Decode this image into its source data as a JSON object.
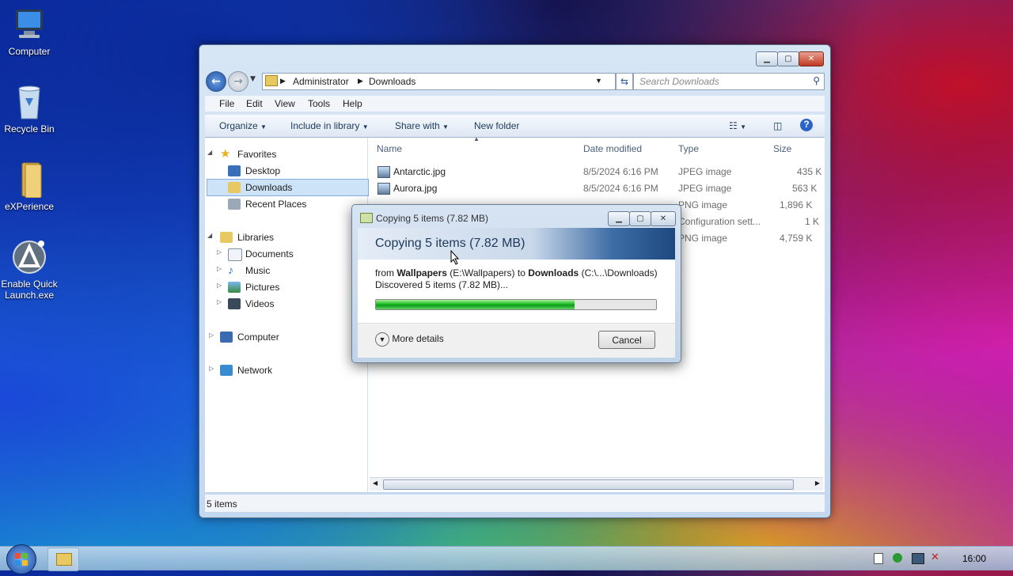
{
  "desktop": {
    "icons": [
      {
        "label": "Computer",
        "icon": "computer-icon"
      },
      {
        "label": "Recycle Bin",
        "icon": "recycle-bin-icon"
      },
      {
        "label": "eXPerience",
        "icon": "folder-icon"
      },
      {
        "label": "Enable Quick Launch.exe",
        "icon": "app-icon"
      }
    ]
  },
  "explorer": {
    "address": {
      "crumb1": "Administrator",
      "crumb2": "Downloads"
    },
    "search_placeholder": "Search Downloads",
    "menu": [
      "File",
      "Edit",
      "View",
      "Tools",
      "Help"
    ],
    "commands": {
      "organize": "Organize",
      "include": "Include in library",
      "share": "Share with",
      "new_folder": "New folder"
    },
    "nav": {
      "favorites": "Favorites",
      "desktop": "Desktop",
      "downloads": "Downloads",
      "recent": "Recent Places",
      "libraries": "Libraries",
      "documents": "Documents",
      "music": "Music",
      "pictures": "Pictures",
      "videos": "Videos",
      "computer": "Computer",
      "network": "Network"
    },
    "columns": {
      "name": "Name",
      "date": "Date modified",
      "type": "Type",
      "size": "Size"
    },
    "files": [
      {
        "name": "Antarctic.jpg",
        "date": "8/5/2024 6:16 PM",
        "type": "JPEG image",
        "size": "435 K"
      },
      {
        "name": "Aurora.jpg",
        "date": "8/5/2024 6:16 PM",
        "type": "JPEG image",
        "size": "563 K"
      },
      {
        "name": "",
        "date": "",
        "type": "PNG image",
        "size": "1,896 K"
      },
      {
        "name": "",
        "date": "",
        "type": "Configuration sett...",
        "size": "1 K"
      },
      {
        "name": "",
        "date": "",
        "type": "PNG image",
        "size": "4,759 K"
      }
    ],
    "status": "5 items"
  },
  "dialog": {
    "title": "Copying 5 items (7.82 MB)",
    "heading": "Copying 5 items (7.82 MB)",
    "from_word": "from",
    "source_name": "Wallpapers",
    "source_path": "(E:\\Wallpapers)",
    "to_word": "to",
    "dest_name": "Downloads",
    "dest_path": "(C:\\...\\Downloads)",
    "discovered": "Discovered 5 items (7.82 MB)...",
    "progress": 0.71,
    "more_details": "More details",
    "cancel": "Cancel"
  },
  "taskbar": {
    "clock": "16:00"
  },
  "colors": {
    "progress_green": "#1bbd25",
    "selection": "#cde3f8"
  }
}
